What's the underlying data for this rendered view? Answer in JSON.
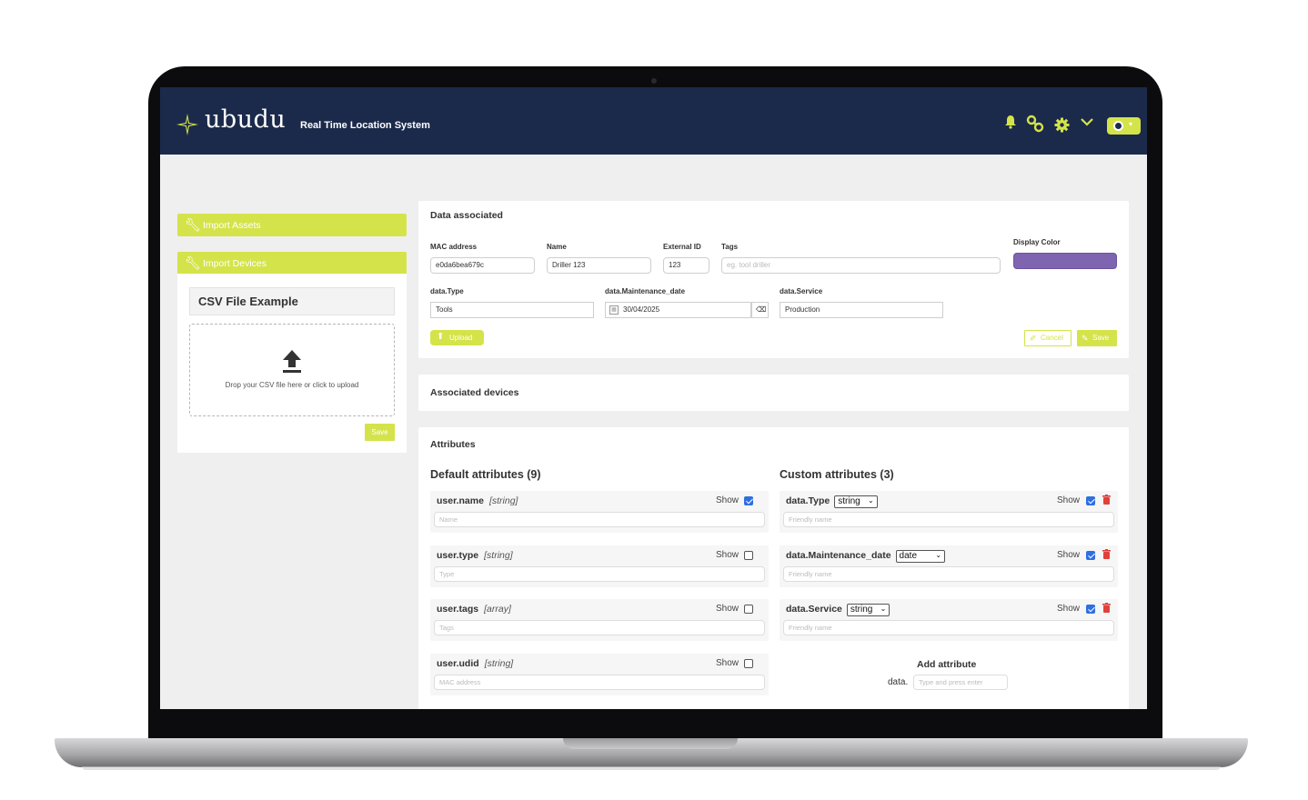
{
  "header": {
    "logo_text": "ubudu",
    "app_title": "Real Time Location System",
    "icons": [
      "bell-icon",
      "link-icon",
      "gear-icon",
      "chevron-down-icon",
      "user-avatar"
    ],
    "accent_color": "#d4e34a",
    "bg_color": "#1b2a4a"
  },
  "sidebar": {
    "import_assets": "Import Assets",
    "import_devices": "Import Devices",
    "csv_title": "CSV File Example",
    "drop_text": "Drop your CSV file here or click to upload",
    "save_label": "Save"
  },
  "data_card": {
    "title": "Data associated",
    "mac_label": "MAC address",
    "mac_value": "e0da6bea679c",
    "name_label": "Name",
    "name_value": "Driller 123",
    "ext_label": "External ID",
    "ext_value": "123",
    "tags_label": "Tags",
    "tags_placeholder": "eg. tool driller",
    "color_label": "Display Color",
    "display_color": "#7f64b0",
    "type_label": "data.Type",
    "type_value": "Tools",
    "maint_label": "data.Maintenance_date",
    "maint_value": "30/04/2025",
    "service_label": "data.Service",
    "service_value": "Production",
    "upload_label": "Upload",
    "cancel_label": "Cancel",
    "save_label": "Save"
  },
  "devices_card": {
    "title": "Associated devices"
  },
  "attributes": {
    "title": "Attributes",
    "default_title": "Default attributes (9)",
    "custom_title": "Custom attributes (3)",
    "show_label": "Show",
    "default": [
      {
        "name": "user.name",
        "type": "[string]",
        "placeholder": "Name",
        "show": true
      },
      {
        "name": "user.type",
        "type": "[string]",
        "placeholder": "Type",
        "show": false
      },
      {
        "name": "user.tags",
        "type": "[array]",
        "placeholder": "Tags",
        "show": false
      },
      {
        "name": "user.udid",
        "type": "[string]",
        "placeholder": "MAC address",
        "show": false
      }
    ],
    "custom": [
      {
        "name": "data.Type",
        "type": "string",
        "placeholder": "Friendly name",
        "show": true
      },
      {
        "name": "data.Maintenance_date",
        "type": "date",
        "placeholder": "Friendly name",
        "show": true
      },
      {
        "name": "data.Service",
        "type": "string",
        "placeholder": "Friendly name",
        "show": true
      }
    ],
    "add_title": "Add attribute",
    "add_prefix": "data.",
    "add_placeholder": "Type and press enter"
  }
}
